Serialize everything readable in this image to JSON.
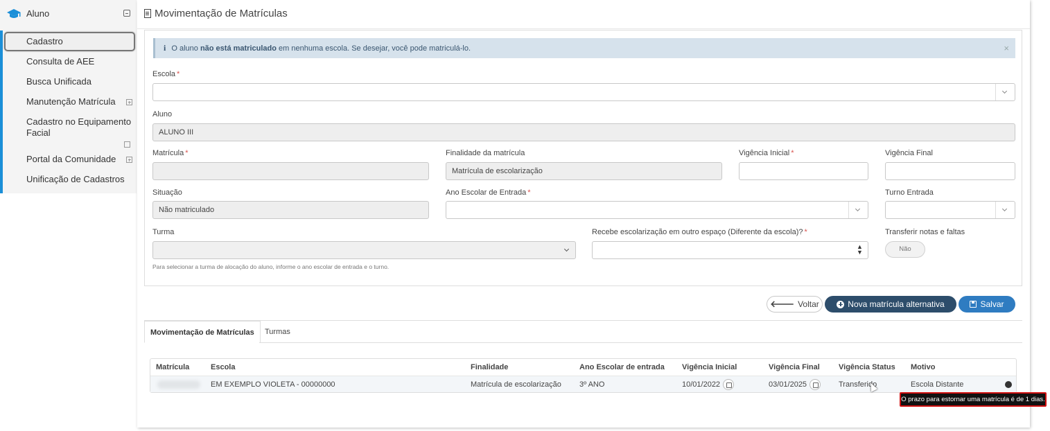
{
  "sidebar": {
    "module": "Aluno",
    "items": [
      {
        "label": "Cadastro"
      },
      {
        "label": "Consulta de AEE"
      },
      {
        "label": "Busca Unificada"
      },
      {
        "label": "Manutenção Matrícula"
      },
      {
        "label": "Cadastro no Equipamento Facial"
      },
      {
        "label": "Portal da Comunidade"
      },
      {
        "label": "Unificação de Cadastros"
      }
    ]
  },
  "page": {
    "title": "Movimentação de Matrículas"
  },
  "alert": {
    "prefix": "O aluno",
    "bold": "não está matriculado",
    "suffix": "em nenhuma escola. Se desejar, você pode matriculá-lo.",
    "close": "×"
  },
  "form": {
    "escola_label": "Escola",
    "escola_value": "",
    "aluno_label": "Aluno",
    "aluno_value": "ALUNO III",
    "matricula_label": "Matrícula",
    "matricula_value": "",
    "finalidade_label": "Finalidade da matrícula",
    "finalidade_value": "Matrícula de escolarização",
    "vig_inicial_label": "Vigência Inicial",
    "vig_final_label": "Vigência Final",
    "situacao_label": "Situação",
    "situacao_value": "Não matriculado",
    "ano_escolar_label": "Ano Escolar de Entrada",
    "turno_label": "Turno Entrada",
    "turma_label": "Turma",
    "turma_hint": "Para selecionar a turma de alocação do aluno, informe o ano escolar de entrada e o turno.",
    "recebe_label": "Recebe escolarização em outro espaço (Diferente da escola)?",
    "transferir_label": "Transferir notas e faltas",
    "transferir_value": "Não",
    "required_mark": "*"
  },
  "actions": {
    "voltar": "Voltar",
    "nova": "Nova matrícula alternativa",
    "salvar": "Salvar"
  },
  "tabs": [
    {
      "label": "Movimentação de Matrículas"
    },
    {
      "label": "Turmas"
    }
  ],
  "table": {
    "headers": [
      "Matrícula",
      "Escola",
      "Finalidade",
      "Ano Escolar de entrada",
      "Vigência Inicial",
      "Vigência Final",
      "Vigência Status",
      "Motivo"
    ],
    "rows": [
      {
        "escola": "EM EXEMPLO VIOLETA - 00000000",
        "finalidade": "Matrícula de escolarização",
        "ano": "3º ANO",
        "vig_inicial": "10/01/2022",
        "vig_final": "03/01/2025",
        "status": "Transferido",
        "motivo": "Escola Distante"
      }
    ]
  },
  "tooltip": "O prazo para estornar uma matrícula é de 1 dias.",
  "colors": {
    "accent": "#1b8fd8",
    "primary_dark": "#2d4d6b",
    "primary": "#2f7cc1",
    "highlight": "#d01010"
  }
}
